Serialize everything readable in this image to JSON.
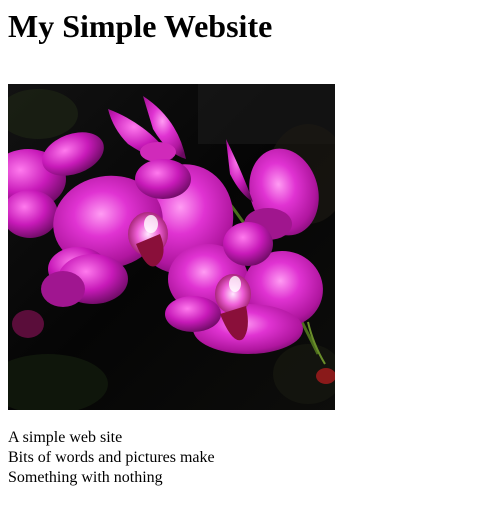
{
  "page": {
    "heading": "My Simple Website",
    "image": {
      "subject": "magenta orchid flowers",
      "background_color": "#0b0b0b",
      "petal_color": "#c020b8"
    },
    "poem": {
      "line1": "A simple web site",
      "line2": "Bits of words and pictures make",
      "line3": "Something with nothing"
    }
  }
}
